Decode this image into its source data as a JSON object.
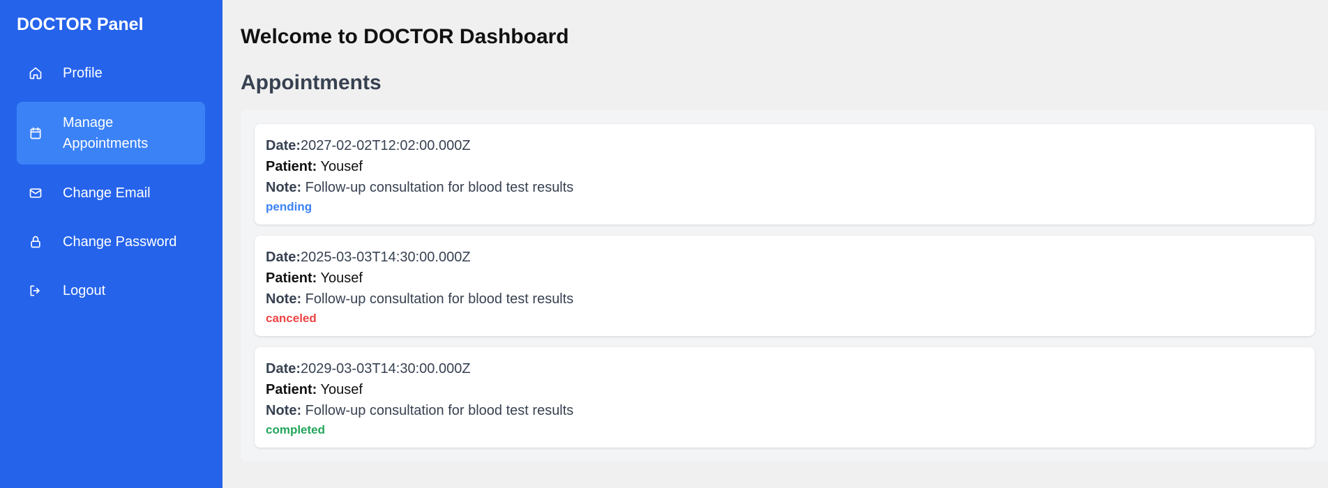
{
  "sidebar": {
    "title": "DOCTOR Panel",
    "items": [
      {
        "label": "Profile",
        "icon": "home-icon",
        "active": false
      },
      {
        "label": "Manage Appointments",
        "icon": "calendar-icon",
        "active": true
      },
      {
        "label": "Change Email",
        "icon": "mail-icon",
        "active": false
      },
      {
        "label": "Change Password",
        "icon": "lock-icon",
        "active": false
      },
      {
        "label": "Logout",
        "icon": "logout-icon",
        "active": false
      }
    ]
  },
  "main": {
    "title": "Welcome to DOCTOR Dashboard",
    "section_title": "Appointments",
    "labels": {
      "date": "Date:",
      "patient": "Patient:",
      "note": "Note:"
    },
    "appointments": [
      {
        "date": "2027-02-02T12:02:00.000Z",
        "patient": "Yousef",
        "note": "Follow-up consultation for blood test results",
        "status": "pending"
      },
      {
        "date": "2025-03-03T14:30:00.000Z",
        "patient": "Yousef",
        "note": "Follow-up consultation for blood test results",
        "status": "canceled"
      },
      {
        "date": "2029-03-03T14:30:00.000Z",
        "patient": "Yousef",
        "note": "Follow-up consultation for blood test results",
        "status": "completed"
      }
    ]
  },
  "colors": {
    "sidebar_bg": "#2563eb",
    "active_item_bg": "#3b82f6",
    "pending": "#3b82f6",
    "canceled": "#ef4444",
    "completed": "#22a55a"
  }
}
